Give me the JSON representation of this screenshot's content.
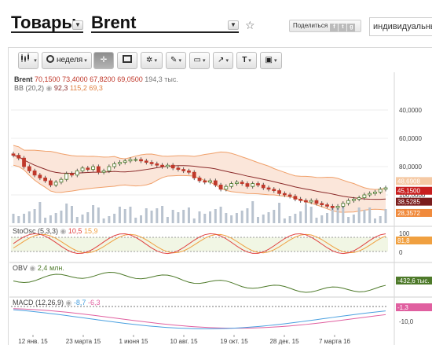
{
  "header": {
    "category": "Товары",
    "instrument": "Brent",
    "share_label": "Поделиться",
    "search_value": "индивидуальный"
  },
  "toolbar": {
    "period_label": "неделя"
  },
  "colors": {
    "candle_up": "#4a7a2a",
    "candle_down": "#c0392b",
    "sma": "#8b2a2a",
    "band_fill": "#fbe6da",
    "band_line": "#f0a06a",
    "volume": "#b9c3cf",
    "stoch_k": "#e04040",
    "stoch_d": "#f0a040",
    "obv": "#4e7a2a",
    "macd": "#4aa0e0",
    "macd_signal": "#e060a0"
  },
  "main_pane": {
    "ticker": "Brent",
    "open": "70,1500",
    "high": "73,4000",
    "low": "67,8200",
    "close": "69,0500",
    "volume": "194,3 тыс.",
    "bb_label": "BB (20,2)",
    "bb_mid": "92,3",
    "bb_upper": "115,2",
    "bb_lower": "69,3",
    "y_ticks": [
      "100,0000",
      "80,0000",
      "60,0000",
      "40,0000"
    ],
    "price_tags": [
      "48,6908",
      "45,1500",
      "38,5285",
      "28,3572"
    ]
  },
  "stoch_pane": {
    "label": "StoOsc (5,3,3)",
    "k": "10,5",
    "d": "15,9",
    "y_ticks": [
      "100",
      "0"
    ],
    "tag": "81,8"
  },
  "obv_pane": {
    "label": "OBV",
    "value": "2,4",
    "unit": "млн.",
    "tag": "-432,6 тыс."
  },
  "macd_pane": {
    "label": "MACD (12,26,9)",
    "macd": "-8,7",
    "signal": "-6,3",
    "y_ticks": [
      "-10,0"
    ],
    "tag": "-1,3"
  },
  "x_axis": [
    "12 янв. 15",
    "23 марта 15",
    "1 июня 15",
    "10 авг. 15",
    "19 окт. 15",
    "28 дек. 15",
    "7 марта 16"
  ],
  "chart_data": {
    "type": "candlestick",
    "title": "Brent",
    "ylim": [
      20,
      110
    ],
    "y_ticks": [
      40,
      60,
      80,
      100
    ],
    "closes": [
      68,
      66,
      60,
      57,
      54,
      52,
      50,
      47,
      49,
      51,
      55,
      54,
      57,
      59,
      58,
      60,
      56,
      57,
      60,
      62,
      63,
      64,
      65,
      65,
      64,
      63,
      62,
      61,
      60,
      61,
      59,
      58,
      57,
      56,
      52,
      50,
      49,
      50,
      47,
      44,
      46,
      48,
      49,
      48,
      46,
      48,
      47,
      45,
      44,
      43,
      41,
      40,
      39,
      37,
      36,
      35,
      36,
      34,
      33,
      32,
      31,
      32,
      34,
      36,
      37,
      38,
      40,
      41,
      42,
      44,
      45
    ]
  }
}
